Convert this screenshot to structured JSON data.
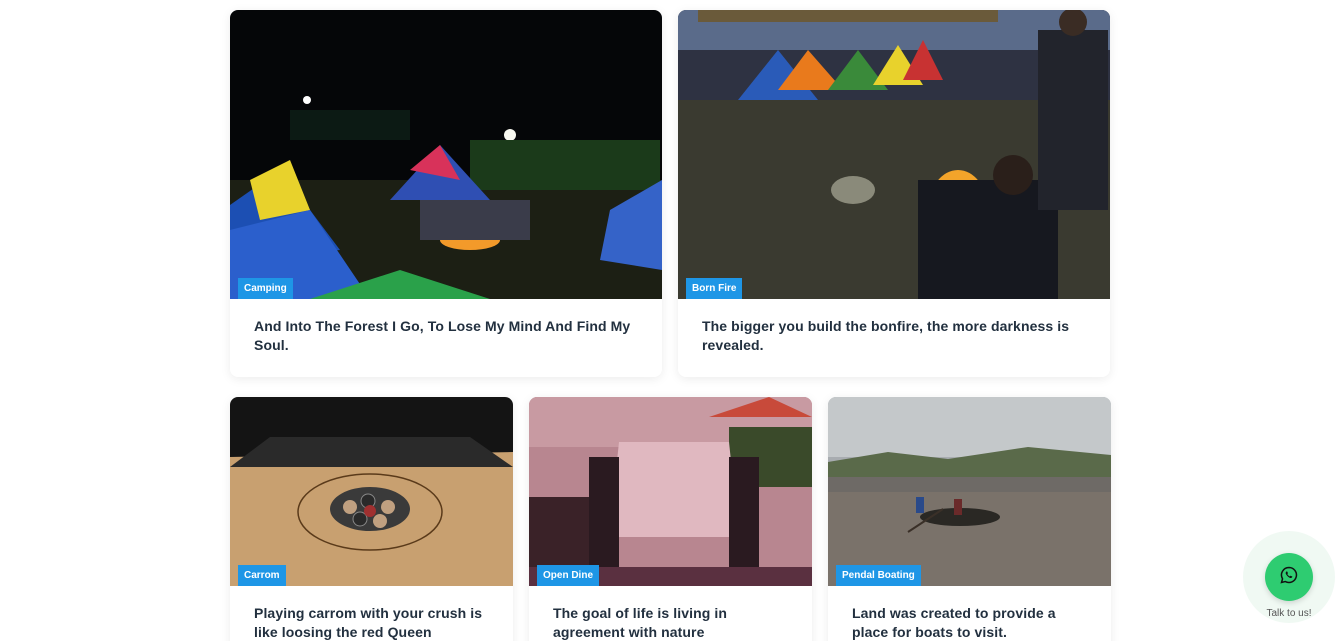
{
  "cards_top": [
    {
      "tag": "Camping",
      "caption": "And Into The Forest I Go, To Lose My Mind And Find My Soul."
    },
    {
      "tag": "Born Fire",
      "caption": "The bigger you build the bonfire, the more darkness is revealed."
    }
  ],
  "cards_bottom": [
    {
      "tag": "Carrom",
      "caption": "Playing carrom with your crush is like loosing the red Queen"
    },
    {
      "tag": "Open Dine",
      "caption": "The goal of life is living in agreement with nature"
    },
    {
      "tag": "Pendal Boating",
      "caption": "Land was created to provide a place for boats to visit."
    }
  ],
  "whatsapp": {
    "label": "Talk to us!",
    "icon": "whatsapp-icon",
    "color": "#2ecc71"
  },
  "colors": {
    "tag_bg": "#1e96e6",
    "caption_text": "#22303f"
  }
}
